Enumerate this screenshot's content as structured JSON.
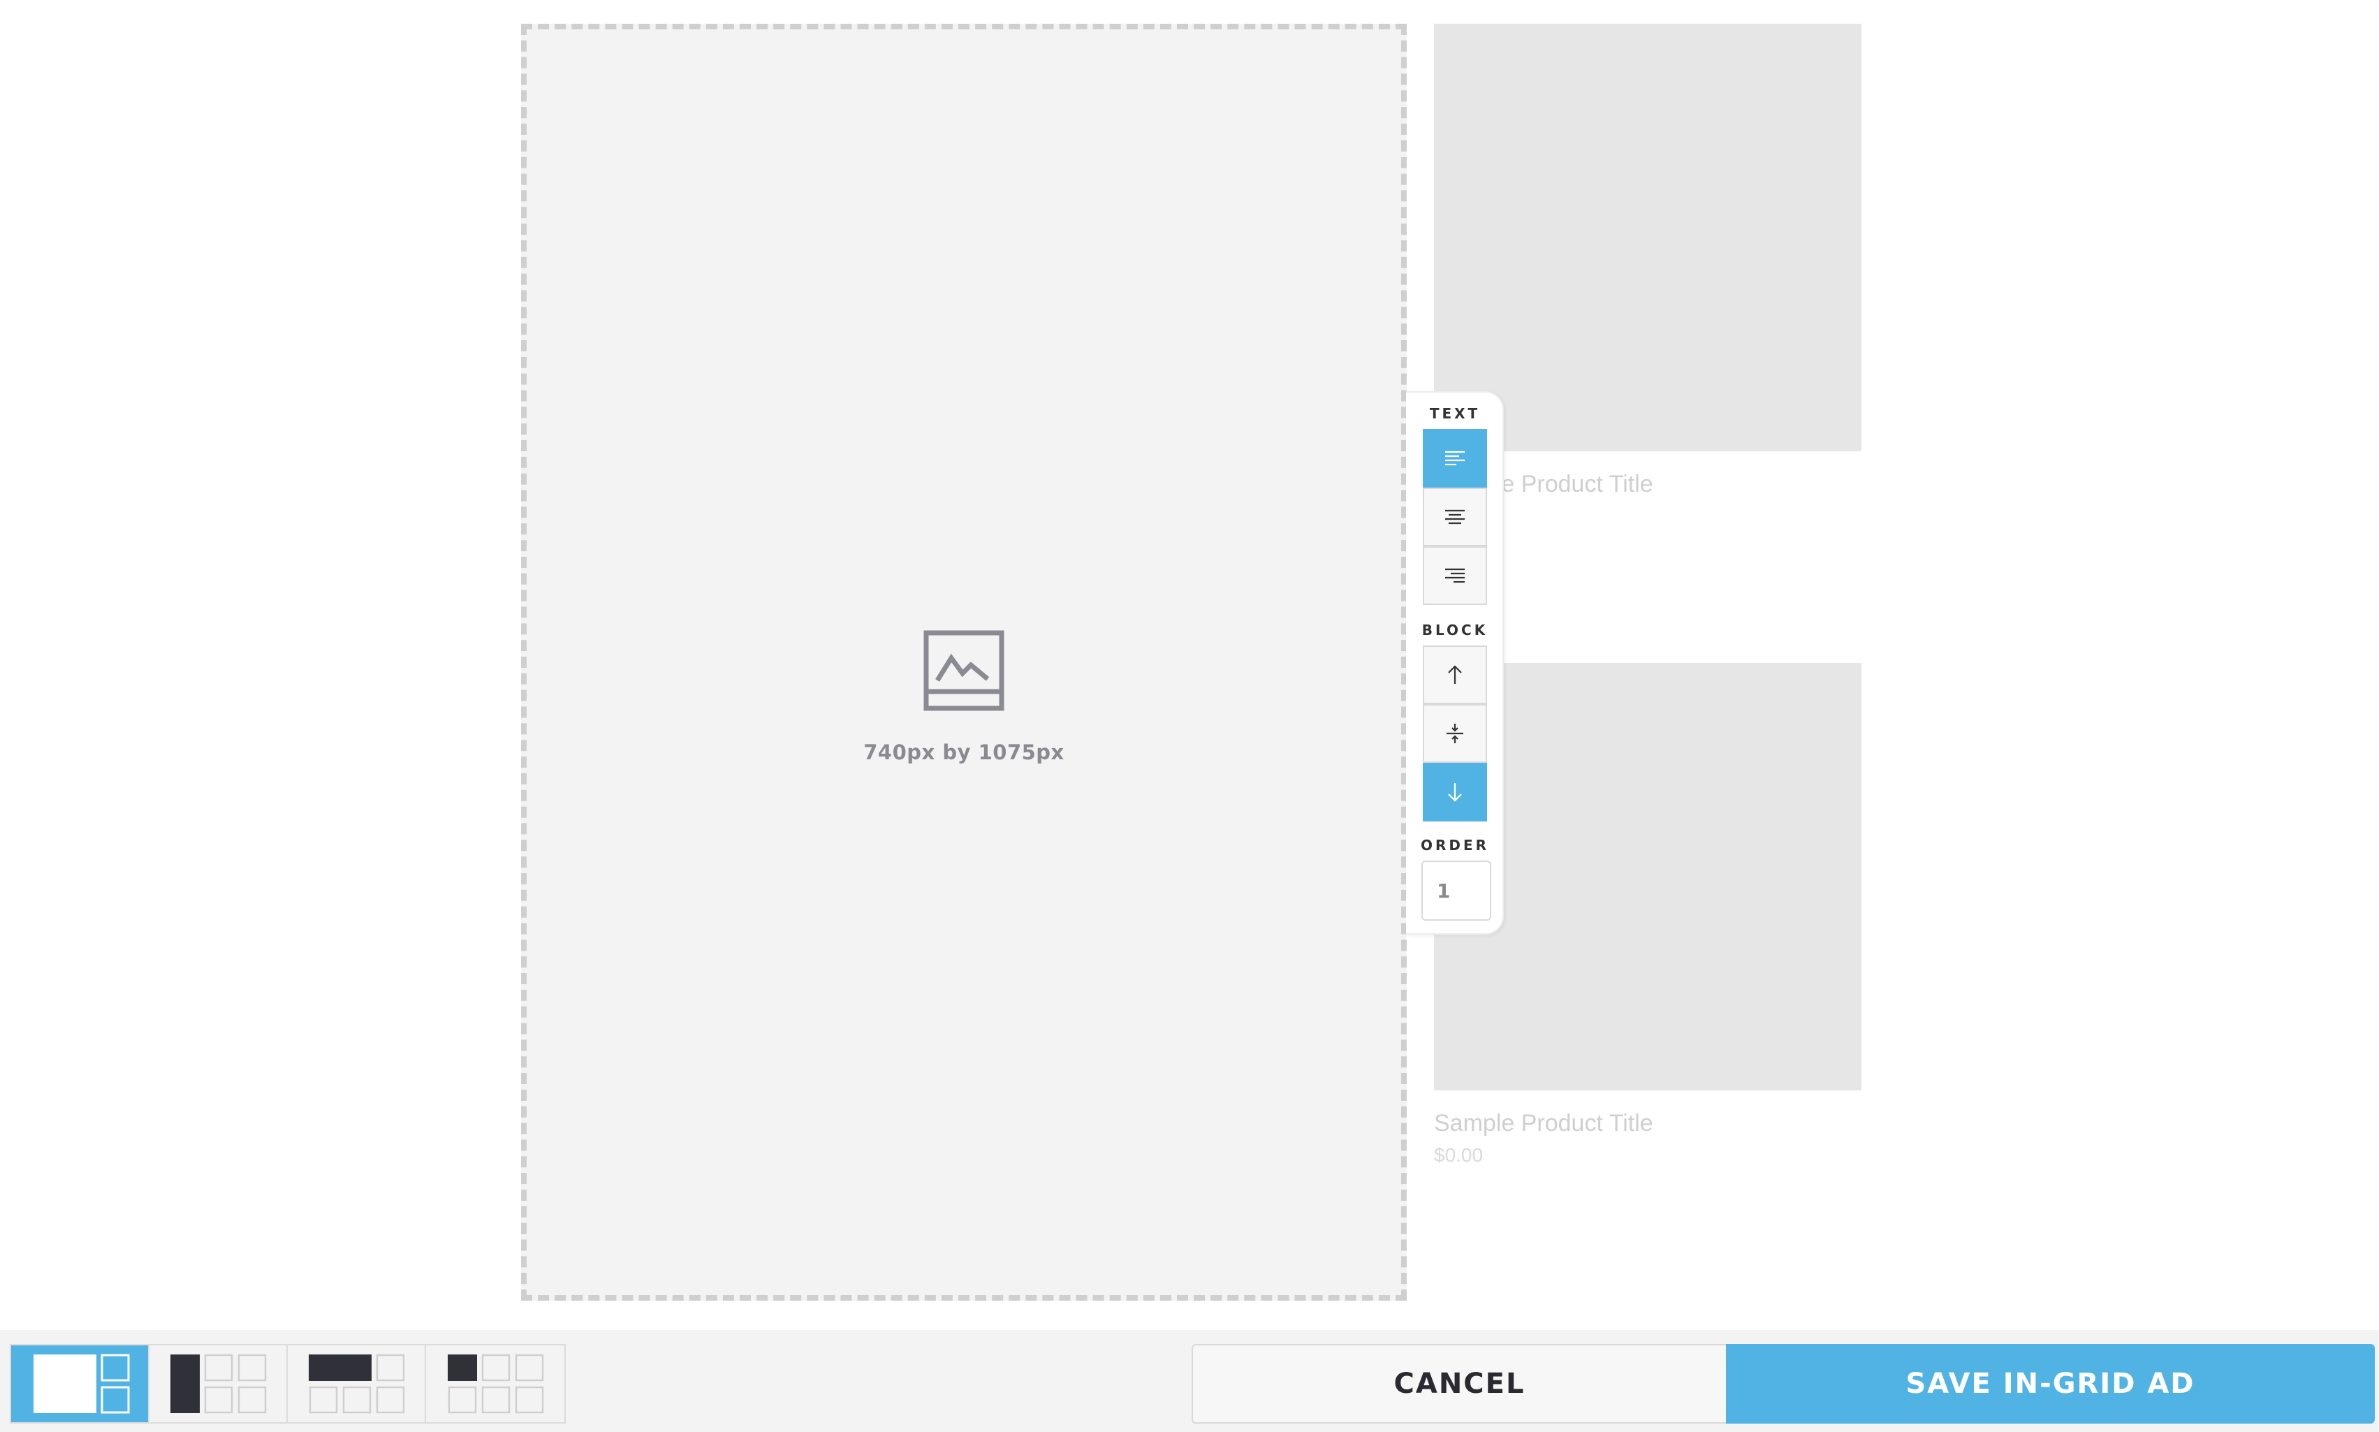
{
  "ad": {
    "size_label": "740px by 1075px",
    "icon": "image-placeholder-icon"
  },
  "products": [
    {
      "title": "Sample Product Title",
      "price": ""
    },
    {
      "title": "Sample Product Title",
      "price": "$0.00"
    }
  ],
  "align_panel": {
    "text_label": "TEXT",
    "text_options": [
      {
        "name": "align-left",
        "icon": "align-left-icon",
        "active": true
      },
      {
        "name": "align-center",
        "icon": "align-center-icon",
        "active": false
      },
      {
        "name": "align-right",
        "icon": "align-right-icon",
        "active": false
      }
    ],
    "block_label": "BLOCK",
    "block_options": [
      {
        "name": "block-top",
        "icon": "arrow-up-icon",
        "active": false
      },
      {
        "name": "block-middle",
        "icon": "vertical-center-icon",
        "active": false
      },
      {
        "name": "block-bottom",
        "icon": "arrow-down-icon",
        "active": true
      }
    ],
    "order_label": "ORDER",
    "order_value": "1"
  },
  "footer": {
    "layouts": [
      {
        "name": "layout-ad-2x2",
        "active": true
      },
      {
        "name": "layout-ad-tall-1x2",
        "active": false
      },
      {
        "name": "layout-ad-wide-2x1",
        "active": false
      },
      {
        "name": "layout-ad-single-1x1",
        "active": false
      }
    ],
    "cancel_label": "CANCEL",
    "save_label": "SAVE IN-GRID AD"
  },
  "colors": {
    "accent": "#51b3e4",
    "dark": "#2f3038",
    "placeholder_bg": "#f3f3f3"
  }
}
